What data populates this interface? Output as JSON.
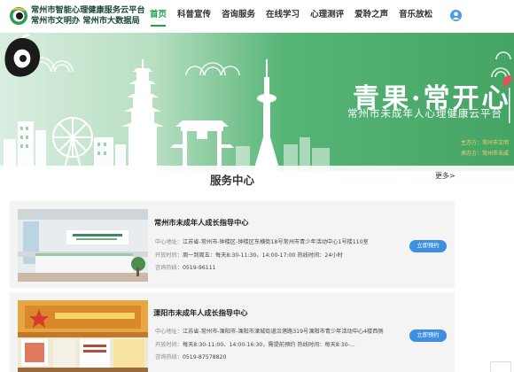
{
  "header": {
    "title_line1": "常州市智能心理健康服务云平台",
    "title_line2": "常州市文明办 常州市大数据局",
    "nav": [
      "首页",
      "科普宣传",
      "咨询服务",
      "在线学习",
      "心理测评",
      "爱聆之声",
      "音乐放松"
    ],
    "active_nav": "首页",
    "accent_color": "#1fa14f"
  },
  "banner": {
    "brand_title": "青果·常开心",
    "brand_subtitle": "常州市未成年人心理健康云平台",
    "organizer_line1": "主办方：常州市文明",
    "organizer_line2": "承办方：常州市未成"
  },
  "services": {
    "section_title": "服务中心",
    "more_label": "更多>",
    "items": [
      {
        "name": "常州市未成年人成长指导中心",
        "address_label": "中心地址：",
        "address": "江苏省-常州市-钟楼区-钟楼区东横街18号常州市青少年活动中心1号楼110室",
        "hours_label": "开放时间：",
        "hours": "周一到周五：每天8:30-11:30、14:00-17:00 热线时间：24小时",
        "phone_label": "咨询热线：",
        "phone": "0519-96111",
        "button_label": "立即预约"
      },
      {
        "name": "溧阳市未成年人成长指导中心",
        "address_label": "中心地址：",
        "address": "江苏省-常州市-溧阳市-溧阳市溧城街道沿港路319号溧阳市青少年活动中心4楼西侧",
        "hours_label": "开放时间：",
        "hours": "每天8:30-11:00、14:00-16:30，需提前预约 热线时间：每天8:30-...",
        "phone_label": "咨询热线：",
        "phone": "0519-87578820",
        "button_label": "立即预约"
      }
    ],
    "button_color": "#3e8fe0"
  },
  "icons": [
    "site-logo-icon",
    "user-avatar-icon",
    "brand-logo-icon",
    "scroll-top-icon"
  ]
}
